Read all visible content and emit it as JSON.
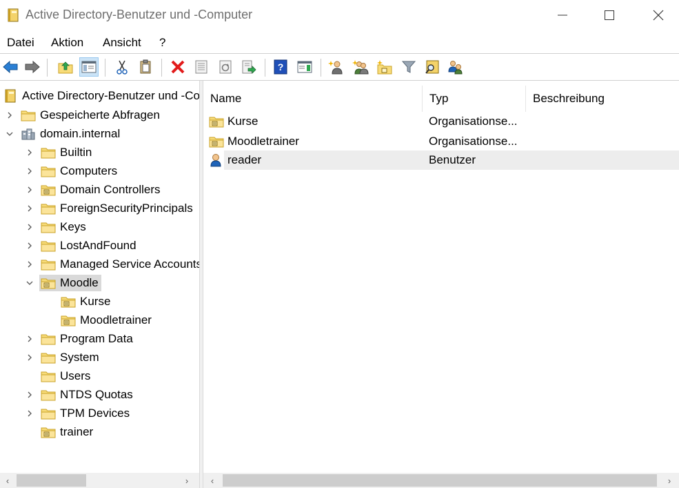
{
  "window": {
    "title": "Active Directory-Benutzer und -Computer"
  },
  "menu": [
    "Datei",
    "Aktion",
    "Ansicht",
    "?"
  ],
  "toolbar": {
    "buttons": [
      "back-icon",
      "forward-icon",
      "up-folder-icon",
      "show-hide-console-tree-icon",
      "cut-icon",
      "paste-icon",
      "delete-icon",
      "properties-icon",
      "refresh-icon",
      "export-list-icon",
      "help-icon",
      "action-pane-icon",
      "new-user-icon",
      "new-group-icon",
      "new-ou-icon",
      "filter-icon",
      "find-icon",
      "add-to-group-icon"
    ]
  },
  "tree": {
    "root": "Active Directory-Benutzer und -Computer",
    "saved_queries": "Gespeicherte Abfragen",
    "domain": "domain.internal",
    "items": [
      {
        "label": "Builtin"
      },
      {
        "label": "Computers"
      },
      {
        "label": "Domain Controllers"
      },
      {
        "label": "ForeignSecurityPrincipals"
      },
      {
        "label": "Keys"
      },
      {
        "label": "LostAndFound"
      },
      {
        "label": "Managed Service Accounts"
      },
      {
        "label": "Moodle"
      },
      {
        "label": "Kurse"
      },
      {
        "label": "Moodletrainer"
      },
      {
        "label": "Program Data"
      },
      {
        "label": "System"
      },
      {
        "label": "Users"
      },
      {
        "label": "NTDS Quotas"
      },
      {
        "label": "TPM Devices"
      },
      {
        "label": "trainer"
      }
    ]
  },
  "list": {
    "columns": [
      "Name",
      "Typ",
      "Beschreibung"
    ],
    "rows": [
      {
        "name": "Kurse",
        "type": "Organisationse...",
        "description": ""
      },
      {
        "name": "Moodletrainer",
        "type": "Organisationse...",
        "description": ""
      },
      {
        "name": "reader",
        "type": "Benutzer",
        "description": ""
      }
    ]
  },
  "colors": {
    "selection": "#d9d9d9",
    "accent": "#0063b1",
    "folder": "#f5d469"
  }
}
